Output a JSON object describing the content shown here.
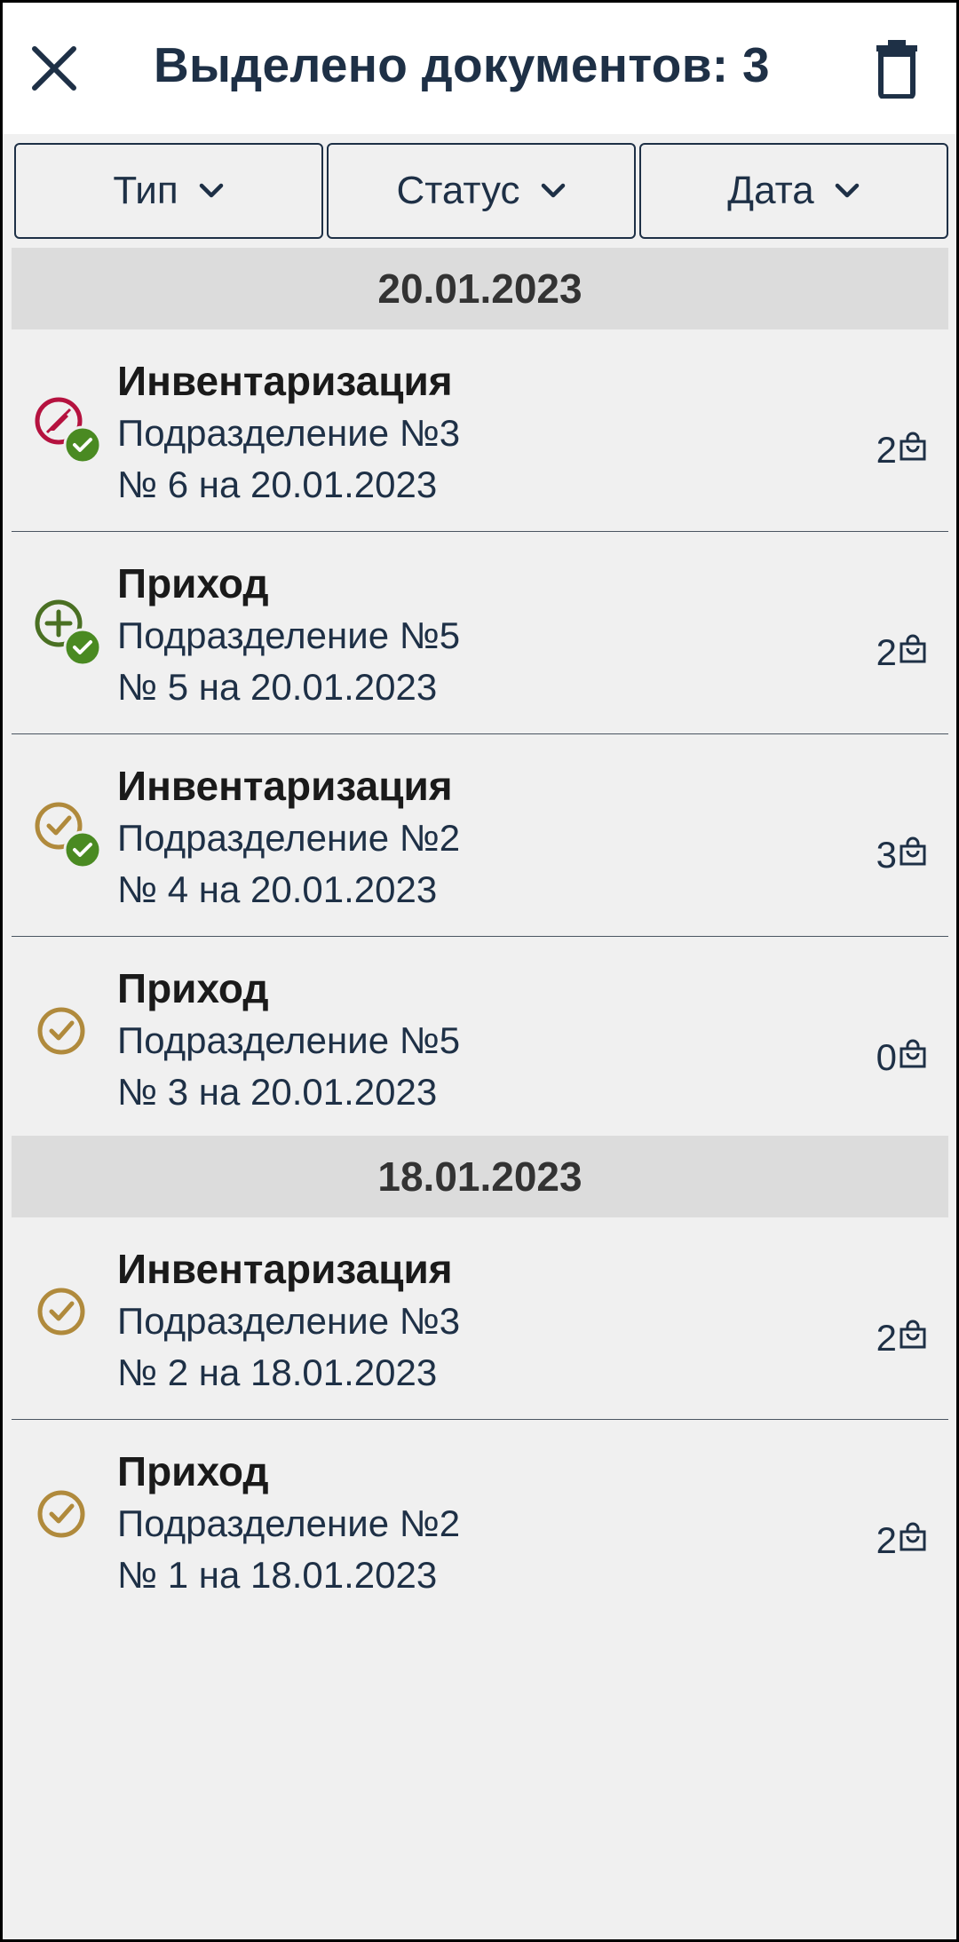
{
  "header": {
    "title": "Выделено документов: 3"
  },
  "filters": [
    {
      "label": "Тип"
    },
    {
      "label": "Статус"
    },
    {
      "label": "Дата"
    }
  ],
  "groups": [
    {
      "date": "20.01.2023",
      "items": [
        {
          "type": "Инвентаризация",
          "dept": "Подразделение №3",
          "number": "№ 6 на 20.01.2023",
          "count": "2",
          "status_icon": "edit-circle-icon",
          "selected": true
        },
        {
          "type": "Приход",
          "dept": "Подразделение №5",
          "number": "№ 5 на 20.01.2023",
          "count": "2",
          "status_icon": "plus-circle-icon",
          "selected": true
        },
        {
          "type": "Инвентаризация",
          "dept": "Подразделение №2",
          "number": "№ 4 на 20.01.2023",
          "count": "3",
          "status_icon": "check-circle-icon",
          "selected": true
        },
        {
          "type": "Приход",
          "dept": "Подразделение №5",
          "number": "№ 3 на 20.01.2023",
          "count": "0",
          "status_icon": "check-circle-icon",
          "selected": false
        }
      ]
    },
    {
      "date": "18.01.2023",
      "items": [
        {
          "type": "Инвентаризация",
          "dept": "Подразделение №3",
          "number": "№ 2 на 18.01.2023",
          "count": "2",
          "status_icon": "check-circle-icon",
          "selected": false
        },
        {
          "type": "Приход",
          "dept": "Подразделение №2",
          "number": "№ 1 на 18.01.2023",
          "count": "2",
          "status_icon": "check-circle-icon",
          "selected": false
        }
      ]
    }
  ],
  "colors": {
    "primary": "#1e3046",
    "edit_status": "#b5123f",
    "new_status": "#4a7023",
    "done_status": "#b08a3c",
    "selected_badge": "#4a8a22",
    "date_header_bg": "#dcdcdc",
    "background": "#f0f0f0"
  }
}
